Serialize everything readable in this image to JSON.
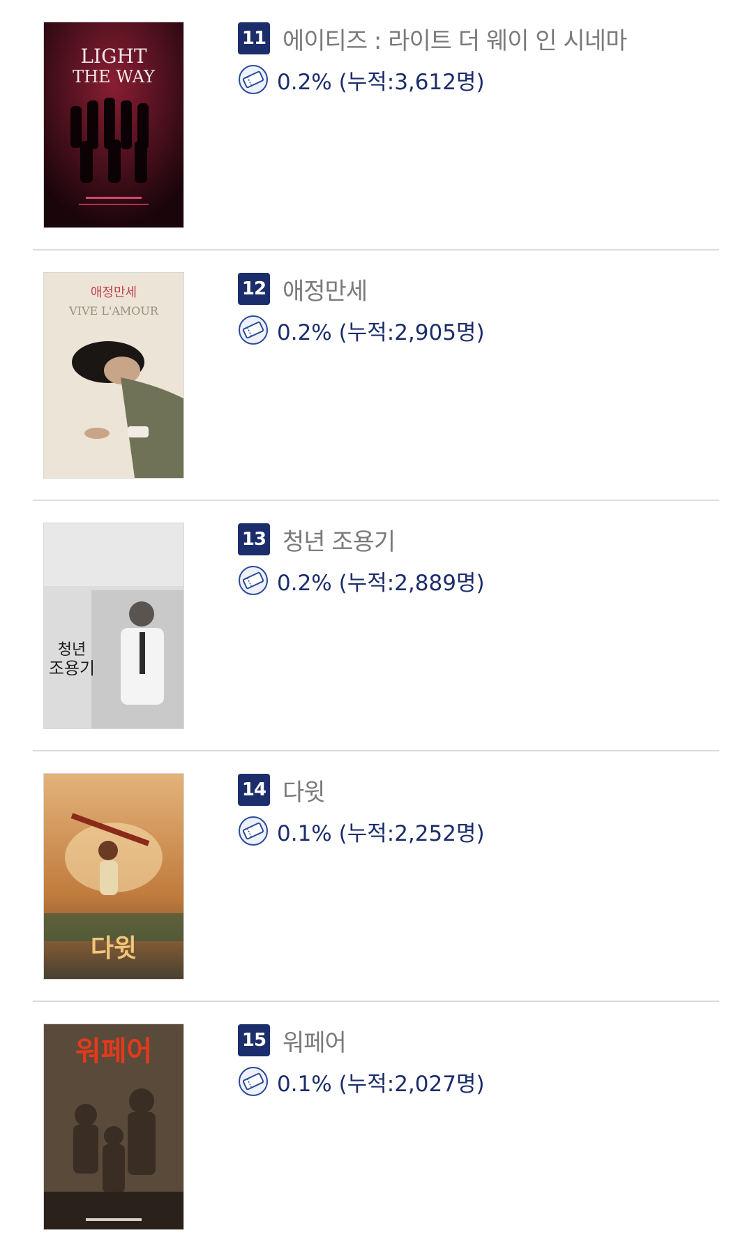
{
  "ranking": {
    "items": [
      {
        "rank": "11",
        "title": "에이티즈 : 라이트 더 웨이 인 시네마",
        "share_text": "0.2% (누적:3,612명)",
        "poster": {
          "headline_1": "LIGHT",
          "headline_2": "THE WAY",
          "bg": "#3a0f1a",
          "accent": "#8a1e33"
        }
      },
      {
        "rank": "12",
        "title": "애정만세",
        "share_text": "0.2% (누적:2,905명)",
        "poster": {
          "headline_1": "애정만세",
          "headline_2": "VIVE L'AMOUR",
          "bg": "#ece4d6",
          "accent": "#c0404e"
        }
      },
      {
        "rank": "13",
        "title": "청년 조용기",
        "share_text": "0.2% (누적:2,889명)",
        "poster": {
          "headline_1": "청년",
          "headline_2": "조용기",
          "bg": "#dcdcdc",
          "accent": "#222222"
        }
      },
      {
        "rank": "14",
        "title": "다윗",
        "share_text": "0.1% (누적:2,252명)",
        "poster": {
          "headline_1": "다윗",
          "headline_2": "",
          "bg": "#c98a4a",
          "accent": "#f3c57a"
        }
      },
      {
        "rank": "15",
        "title": "워페어",
        "share_text": "0.1% (누적:2,027명)",
        "poster": {
          "headline_1": "워페어",
          "headline_2": "",
          "bg": "#5a4a3a",
          "accent": "#e23a1d"
        }
      }
    ]
  },
  "colors": {
    "rank_bg": "#1b2d6b",
    "stat_text": "#1b2d6b",
    "title_text": "#7a7a7a",
    "divider": "#dcdcdc"
  },
  "icons": {
    "share": "ticket-icon"
  }
}
